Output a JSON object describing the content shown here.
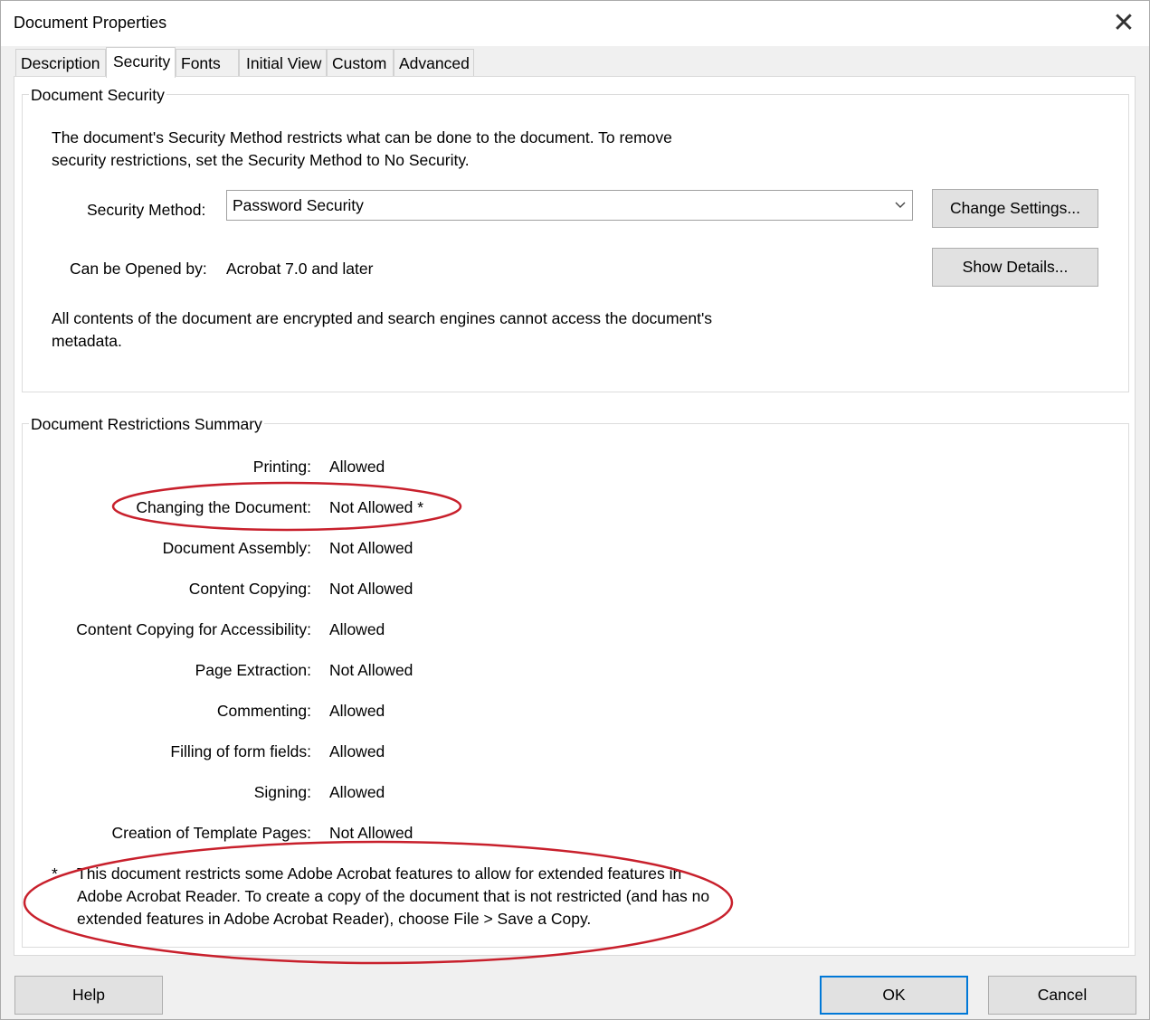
{
  "window": {
    "title": "Document Properties"
  },
  "tabs": [
    {
      "label": "Description"
    },
    {
      "label": "Security"
    },
    {
      "label": "Fonts"
    },
    {
      "label": "Initial View"
    },
    {
      "label": "Custom"
    },
    {
      "label": "Advanced"
    }
  ],
  "active_tab": "Security",
  "document_security": {
    "legend": "Document Security",
    "intro_line1": "The document's Security Method restricts what can be done to the document. To remove",
    "intro_line2": "security restrictions, set the Security Method to No Security.",
    "method_label": "Security Method:",
    "method_value": "Password Security",
    "opened_by_label": "Can be Opened by:",
    "opened_by_value": "Acrobat 7.0 and later",
    "change_settings_label": "Change Settings...",
    "show_details_label": "Show Details...",
    "encryption_line1": "All contents of the document are encrypted and search engines cannot access the document's",
    "encryption_line2": "metadata."
  },
  "restrictions": {
    "legend": "Document Restrictions Summary",
    "rows": [
      {
        "label": "Printing:",
        "value": "Allowed"
      },
      {
        "label": "Changing the Document:",
        "value": "Not Allowed *"
      },
      {
        "label": "Document Assembly:",
        "value": "Not Allowed"
      },
      {
        "label": "Content Copying:",
        "value": "Not Allowed"
      },
      {
        "label": "Content Copying for Accessibility:",
        "value": "Allowed"
      },
      {
        "label": "Page Extraction:",
        "value": "Not Allowed"
      },
      {
        "label": "Commenting:",
        "value": "Allowed"
      },
      {
        "label": "Filling of form fields:",
        "value": "Allowed"
      },
      {
        "label": "Signing:",
        "value": "Allowed"
      },
      {
        "label": "Creation of Template Pages:",
        "value": "Not Allowed"
      }
    ],
    "footnote_marker": "*",
    "footnote_line1": "This document restricts some Adobe Acrobat features to allow for extended features in",
    "footnote_line2": "Adobe Acrobat Reader. To create a copy of the document that is not restricted (and has no",
    "footnote_line3": "extended features in Adobe Acrobat Reader), choose File > Save a Copy."
  },
  "footer": {
    "help_label": "Help",
    "ok_label": "OK",
    "cancel_label": "Cancel"
  },
  "colors": {
    "annotation_ellipse": "#c8202c",
    "default_button_border": "#0078d7"
  }
}
